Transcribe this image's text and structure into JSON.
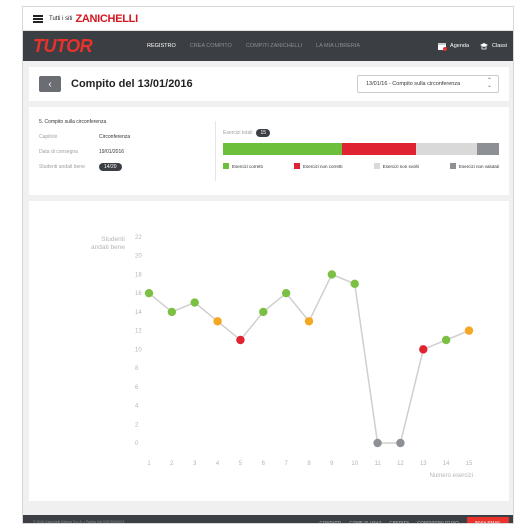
{
  "topbar": {
    "sites_label": "Tutti i siti",
    "brand": "ZANICHELLI"
  },
  "navbar": {
    "logo": "TUTOR",
    "items": [
      {
        "label": "REGISTRO",
        "active": true
      },
      {
        "label": "CREA COMPITO",
        "active": false
      },
      {
        "label": "COMPITI ZANICHELLI",
        "active": false
      },
      {
        "label": "LA MIA LIBRERIA",
        "active": false
      }
    ],
    "agenda_label": "Agenda",
    "classi_label": "Classi"
  },
  "title_card": {
    "back_icon": "chevron-left-icon",
    "title": "Compito del 13/01/2016",
    "select_value": "13/01/16 - Compito sulla circonferenza"
  },
  "info": {
    "heading": "5. Compito sulla circonferenza",
    "rows": [
      {
        "key": "Capitolo",
        "value": "Circonferenza",
        "pill": false
      },
      {
        "key": "Data di consegna",
        "value": "19/01/2016",
        "pill": false
      },
      {
        "key": "Studenti andati bene",
        "value": "14/20",
        "pill": true
      }
    ],
    "total_label": "Esercizi totali",
    "total_value": "15",
    "breakdown": [
      {
        "label": "Esercizi corretti",
        "fraction": 0.43,
        "color": "#6bbf3a"
      },
      {
        "label": "Esercizi non corretti",
        "fraction": 0.27,
        "color": "#e02330"
      },
      {
        "label": "Esercizi non svolti",
        "fraction": 0.22,
        "color": "#d9d9d9"
      },
      {
        "label": "Esercizi non valutati",
        "fraction": 0.08,
        "color": "#8d9196"
      }
    ]
  },
  "chart_data": {
    "type": "line",
    "ylabel": "Studenti andati bene",
    "xlabel": "Numero esercizi",
    "x": [
      1,
      2,
      3,
      4,
      5,
      6,
      7,
      8,
      9,
      10,
      11,
      12,
      13,
      14,
      15
    ],
    "yticks": [
      0,
      2,
      4,
      6,
      8,
      10,
      12,
      14,
      16,
      18,
      20,
      22
    ],
    "ylim": [
      0,
      22
    ],
    "series": [
      {
        "values": [
          16,
          14,
          15,
          13,
          11,
          14,
          16,
          13,
          18,
          17,
          0,
          0,
          10,
          11,
          12
        ],
        "point_colors": [
          "#7bc043",
          "#7bc043",
          "#7bc043",
          "#f5a623",
          "#e02330",
          "#7bc043",
          "#7bc043",
          "#f5a623",
          "#7bc043",
          "#7bc043",
          "#8d9196",
          "#8d9196",
          "#e02330",
          "#7bc043",
          "#f5a623"
        ]
      }
    ],
    "line_color": "#cfcfcf",
    "grid": false
  },
  "footer": {
    "legal": "© 2016 Zanichelli Editore S.p.A. • Partita IVA 03978000374",
    "links": [
      "CONTATTI",
      "COME SI USA?",
      "CREDITS",
      "CONDIZIONI D'USO"
    ],
    "cta": "INVIA EMAIL"
  }
}
